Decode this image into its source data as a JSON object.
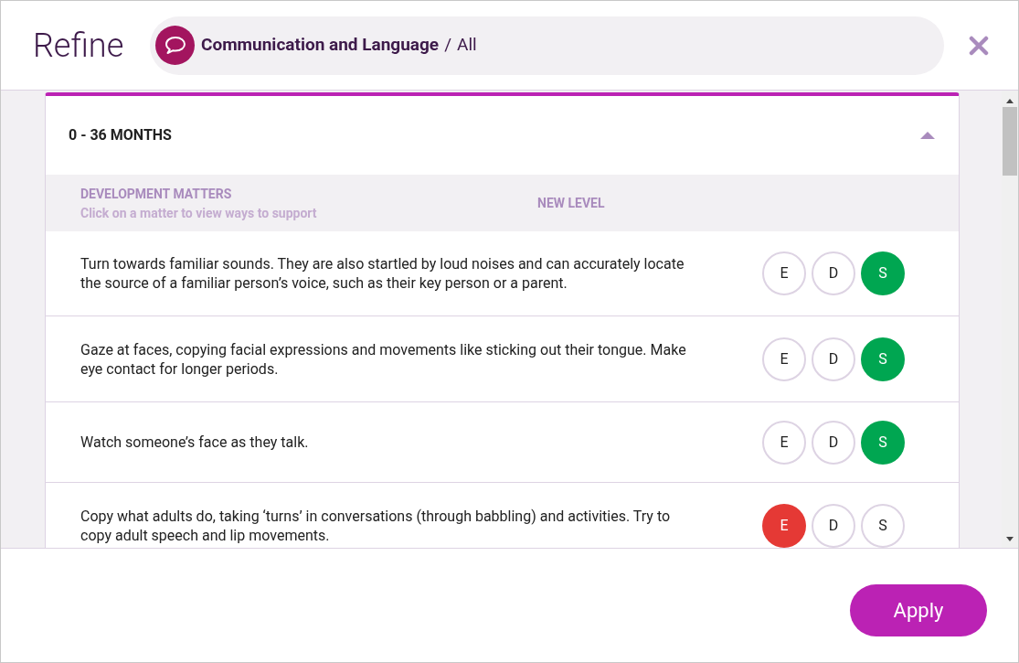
{
  "header": {
    "title": "Refine",
    "breadcrumb": {
      "area": "Communication and Language",
      "separator": "/",
      "filter": "All"
    }
  },
  "section": {
    "title": "0 - 36 MONTHS",
    "expanded": true,
    "columns": {
      "matters": "DEVELOPMENT MATTERS",
      "hint": "Click on a matter to view ways to support",
      "level": "NEW LEVEL"
    },
    "rows": [
      {
        "text": "Turn towards familiar sounds. They are also startled by loud noises and can accurately locate the source of a familiar person’s voice, such as their key person or a parent.",
        "levels": [
          {
            "label": "E",
            "selected": false
          },
          {
            "label": "D",
            "selected": false
          },
          {
            "label": "S",
            "selected": true,
            "color": "#00a651"
          }
        ]
      },
      {
        "text": "Gaze at faces, copying facial expressions and movements like sticking out their tongue. Make eye contact for longer periods.",
        "levels": [
          {
            "label": "E",
            "selected": false
          },
          {
            "label": "D",
            "selected": false
          },
          {
            "label": "S",
            "selected": true,
            "color": "#00a651"
          }
        ]
      },
      {
        "text": "Watch someone’s face as they talk.",
        "levels": [
          {
            "label": "E",
            "selected": false
          },
          {
            "label": "D",
            "selected": false
          },
          {
            "label": "S",
            "selected": true,
            "color": "#00a651"
          }
        ]
      },
      {
        "text": "Copy what adults do, taking ‘turns’ in conversations (through babbling) and activities. Try to copy adult speech and lip movements.",
        "levels": [
          {
            "label": "E",
            "selected": true,
            "color": "#e53935"
          },
          {
            "label": "D",
            "selected": false
          },
          {
            "label": "S",
            "selected": false
          }
        ]
      }
    ]
  },
  "footer": {
    "apply": "Apply"
  }
}
